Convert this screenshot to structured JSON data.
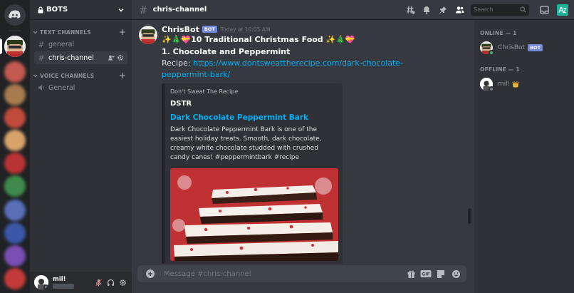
{
  "server": {
    "name": "BOTS"
  },
  "categories": {
    "text": "TEXT CHANNELS",
    "voice": "VOICE CHANNELS"
  },
  "text_channels": [
    {
      "name": "general"
    },
    {
      "name": "chris-channel"
    }
  ],
  "voice_channels": [
    {
      "name": "General"
    }
  ],
  "current_user": {
    "name": "mil!"
  },
  "header": {
    "channel": "chris-channel",
    "search_placeholder": "Search"
  },
  "message": {
    "author": "ChrisBot",
    "badge": "BOT",
    "timestamp": "Today at 10:05 AM",
    "title_line": "✨🎄💝10 Traditional Christmas Food ✨🎄💝",
    "item_heading": "1. Chocolate and Peppermint",
    "recipe_prefix": "Recipe: ",
    "recipe_link": "https://www.dontsweattherecipe.com/dark-chocolate-peppermint-bark/"
  },
  "embed": {
    "provider": "Don't Sweat The Recipe",
    "author": "DSTR",
    "title": "Dark Chocolate Peppermint Bark",
    "description": "Dark Chocolate Peppermint Bark is one of the easiest holiday treats. Smooth, dark chocolate, creamy white chocolate studded with crushed candy canes! #peppermintbark #recipe"
  },
  "composer": {
    "placeholder": "Message #chris-channel"
  },
  "members": {
    "online_label": "ONLINE — 1",
    "offline_label": "OFFLINE — 1",
    "online": [
      {
        "name": "ChrisBot",
        "badge": "BOT"
      }
    ],
    "offline": [
      {
        "name": "mil!",
        "emoji": "👑"
      }
    ]
  },
  "colors": {
    "blurple": "#7289da",
    "link": "#00b0f4",
    "online": "#43b581",
    "offline": "#747f8d"
  }
}
